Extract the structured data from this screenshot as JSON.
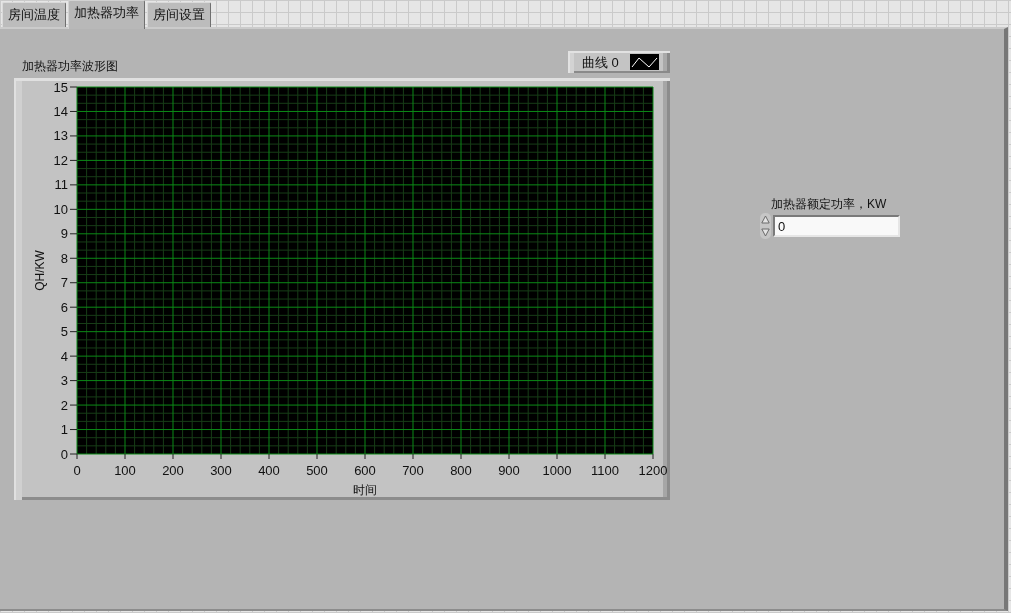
{
  "tabs": [
    {
      "label": "房间温度",
      "selected": false
    },
    {
      "label": "加热器功率",
      "selected": true
    },
    {
      "label": "房间设置",
      "selected": false
    }
  ],
  "waveform_chart": {
    "legend": [
      {
        "label": "曲线 0"
      }
    ],
    "chart_data": {
      "type": "line",
      "title": "加热器功率波形图",
      "xlabel": "时间",
      "ylabel": "QH/KW",
      "categories": [
        "0",
        "100",
        "200",
        "300",
        "400",
        "500",
        "600",
        "700",
        "800",
        "900",
        "1000",
        "1100",
        "1200"
      ],
      "ylim": [
        0,
        15
      ],
      "yticks": [
        0,
        1,
        2,
        3,
        4,
        5,
        6,
        7,
        8,
        9,
        10,
        11,
        12,
        13,
        14,
        15
      ],
      "grid": true
    }
  },
  "numeric_control": {
    "label": "加热器额定功率，KW",
    "value": "0"
  }
}
